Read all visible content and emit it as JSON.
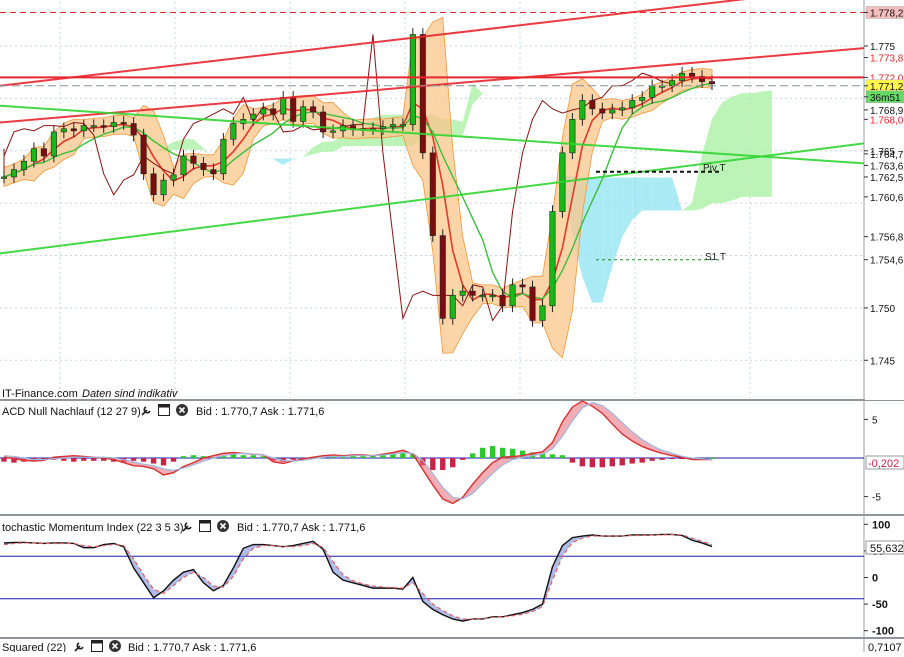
{
  "colors": {
    "resistance_line": "#e8262d",
    "support_line": "#31d431",
    "bollinger_fill": "#f9c78b",
    "cloud_bull": "#a6f0a0",
    "cloud_bear": "#8ee3f2",
    "candle_up": "#18b818",
    "candle_down": "#7a0d0d",
    "price_line": "#2a2a2a",
    "macd_pos_bar": "#2ec72e",
    "macd_neg_bar": "#c8244a",
    "zero_line": "#1b1bb0",
    "grid": "#c6d7e6",
    "axis_text": "#111111",
    "highlight_label_bg": "#fff84a",
    "current_label_bg": "#66d966",
    "top_label_bg": "#f5bdbd"
  },
  "main_panel": {
    "watermark": "IT-Finance.com",
    "disclaimer": "Daten sind indikativ",
    "level_tags": {
      "pivot": "Piv T",
      "s1": "S1 T"
    },
    "price_labels": [
      "1.778,2",
      "1.775",
      "1.773,8",
      "1.772,0",
      "1.771,2",
      "36m51",
      "1.768,9",
      "1.768,0",
      "1.765",
      "1.764,7",
      "1.763,6",
      "1.762,5",
      "1.760,6",
      "1.756,8",
      "1.754,6",
      "1.750",
      "1.745"
    ]
  },
  "macd_panel": {
    "title": "ACD Null Nachlauf (12 27 9)",
    "bid_ask": "Bid : 1.770,7 Ask : 1.771,6",
    "axis_ticks": [
      "5",
      "-5"
    ],
    "current_value": "-0,202"
  },
  "smi_panel": {
    "title": "tochastic Momentum Index (22 3 5 3)",
    "bid_ask": "Bid : 1.770,7 Ask : 1.771,6",
    "axis_ticks": [
      "100",
      "50",
      "0",
      "-50",
      "-100"
    ],
    "current_value": "55,632"
  },
  "bottom_panel": {
    "title": "Squared (22)",
    "bid_ask": "Bid : 1.770,7 Ask : 1.771,6",
    "current_value": "0,7107"
  },
  "toolbar_icons": [
    "wrench-icon",
    "window-icon",
    "close-icon"
  ],
  "chart_data": [
    {
      "type": "line",
      "name": "main-price",
      "y_axis_ticks": [
        1.745,
        1.75,
        1.755,
        1.76,
        1.765,
        1.77,
        1.775
      ],
      "ylim": [
        1.7414,
        1.7792
      ],
      "x": [
        0,
        10,
        20,
        30,
        40,
        50,
        60,
        70,
        80,
        90,
        100,
        110,
        120,
        130,
        140,
        150,
        160,
        170,
        180,
        190,
        200,
        210,
        220,
        230,
        240,
        250,
        260,
        270,
        280,
        290,
        300,
        310,
        320,
        330,
        340,
        350,
        360,
        370,
        380,
        390,
        400,
        410,
        420,
        430,
        440,
        450,
        460,
        470,
        480,
        490,
        500,
        510,
        520,
        530,
        540,
        550,
        560,
        570,
        580,
        590,
        600,
        610,
        620,
        630,
        640,
        650,
        660,
        670,
        680,
        690,
        700,
        710
      ],
      "close": [
        1.7625,
        1.7632,
        1.764,
        1.7652,
        1.7645,
        1.7668,
        1.7671,
        1.7669,
        1.7674,
        1.7674,
        1.7673,
        1.7677,
        1.7676,
        1.7665,
        1.7628,
        1.7608,
        1.7622,
        1.7627,
        1.7645,
        1.7638,
        1.7632,
        1.7628,
        1.7661,
        1.7676,
        1.768,
        1.7685,
        1.769,
        1.7685,
        1.7701,
        1.7678,
        1.7692,
        1.7687,
        1.7668,
        1.7669,
        1.7674,
        1.767,
        1.7671,
        1.7671,
        1.7673,
        1.7675,
        1.7675,
        1.7761,
        1.7648,
        1.7569,
        1.749,
        1.7512,
        1.7516,
        1.7512,
        1.7512,
        1.7512,
        1.7502,
        1.7522,
        1.752,
        1.7488,
        1.7502,
        1.7592,
        1.7648,
        1.768,
        1.7698,
        1.769,
        1.7686,
        1.7689,
        1.7691,
        1.7698,
        1.7701,
        1.7712,
        1.7712,
        1.7717,
        1.7724,
        1.7721,
        1.7716,
        1.7714
      ],
      "series": [
        {
          "name": "",
          "kind": "trendline",
          "color": "#e8262d",
          "y_at_start": 1.7712,
          "y_at_end": 1.7808
        },
        {
          "name": "",
          "kind": "trendline",
          "color": "#e8262d",
          "y_at_start": 1.7677,
          "y_at_end": 1.7748
        },
        {
          "name": "",
          "kind": "horizontal",
          "color": "#e8262d",
          "y": 1.772
        },
        {
          "name": "",
          "kind": "trendline",
          "color": "#31d431",
          "y_at_start": 1.7693,
          "y_at_end": 1.7638
        },
        {
          "name": "",
          "kind": "trendline",
          "color": "#31d431",
          "y_at_start": 1.7552,
          "y_at_end": 1.7657
        }
      ],
      "levels": {
        "top_dashed": 1.7782,
        "pivot": 1.763,
        "s1": 1.7546
      },
      "last_price": 1.7712
    },
    {
      "type": "bar",
      "name": "macd",
      "ylim": [
        -7,
        7
      ],
      "axis_ticks": [
        5,
        -5
      ],
      "x": [
        0,
        10,
        20,
        30,
        40,
        50,
        60,
        70,
        80,
        90,
        100,
        110,
        120,
        130,
        140,
        150,
        160,
        170,
        180,
        190,
        200,
        210,
        220,
        230,
        240,
        250,
        260,
        270,
        280,
        290,
        300,
        310,
        320,
        330,
        340,
        350,
        360,
        370,
        380,
        390,
        400,
        410,
        420,
        430,
        440,
        450,
        460,
        470,
        480,
        490,
        500,
        510,
        520,
        530,
        540,
        550,
        560,
        570,
        580,
        590,
        600,
        610,
        620,
        630,
        640,
        650,
        660,
        670,
        680,
        690,
        700,
        710
      ],
      "histogram": [
        -0.4,
        -0.5,
        -0.4,
        -0.3,
        -0.2,
        -0.2,
        -0.3,
        -0.4,
        -0.3,
        -0.3,
        -0.3,
        -0.4,
        -0.5,
        -0.3,
        -0.4,
        -0.6,
        -0.8,
        -0.4,
        0.2,
        0.3,
        0.2,
        0.1,
        0.2,
        0.4,
        0.3,
        0.3,
        0.2,
        -0.3,
        -0.4,
        -0.2,
        -0.1,
        0.1,
        0.1,
        0.2,
        0.1,
        0.2,
        0.2,
        0.3,
        0.3,
        0.5,
        0.6,
        0.4,
        -0.8,
        -1.3,
        -1.3,
        -1.0,
        -0.2,
        0.5,
        1.1,
        1.3,
        1.1,
        1.0,
        0.8,
        0.6,
        0.5,
        0.4,
        0.3,
        -0.5,
        -0.9,
        -1.0,
        -1.0,
        -0.9,
        -0.8,
        -0.6,
        -0.5,
        -0.3,
        -0.2,
        -0.1,
        -0.1,
        0.0,
        0.0,
        0.0
      ],
      "macd_line": [
        0.1,
        -0.1,
        -0.3,
        -0.4,
        -0.3,
        0.1,
        0.2,
        0.3,
        0.2,
        0.1,
        0.0,
        -0.2,
        -0.6,
        -1.0,
        -1.1,
        -1.4,
        -2.2,
        -1.9,
        -1.1,
        -0.6,
        0.0,
        0.3,
        0.6,
        0.7,
        0.6,
        0.5,
        0.4,
        -0.5,
        -0.7,
        -0.4,
        -0.1,
        0.1,
        0.3,
        0.4,
        0.3,
        0.4,
        0.4,
        0.3,
        0.5,
        0.7,
        1.0,
        0.5,
        -1.5,
        -3.5,
        -5.3,
        -5.9,
        -5.1,
        -3.4,
        -1.9,
        -0.6,
        0.1,
        0.2,
        0.3,
        0.6,
        0.8,
        2.0,
        4.7,
        6.6,
        7.4,
        6.7,
        5.8,
        4.4,
        3.1,
        2.2,
        1.5,
        1.0,
        0.6,
        0.3,
        0.1,
        -0.2,
        -0.2,
        -0.2
      ],
      "signal_line": [
        0.3,
        0.2,
        0.0,
        -0.2,
        -0.2,
        -0.1,
        0.0,
        0.1,
        0.1,
        0.1,
        0.1,
        0.0,
        -0.2,
        -0.5,
        -0.8,
        -1.0,
        -1.4,
        -1.6,
        -1.3,
        -0.9,
        -0.4,
        0.0,
        0.3,
        0.5,
        0.6,
        0.5,
        0.4,
        0.0,
        -0.3,
        -0.4,
        -0.3,
        -0.1,
        0.1,
        0.2,
        0.2,
        0.3,
        0.3,
        0.3,
        0.4,
        0.5,
        0.7,
        0.6,
        -0.3,
        -2.0,
        -3.8,
        -5.1,
        -5.3,
        -4.6,
        -3.3,
        -2.0,
        -0.9,
        -0.2,
        0.1,
        0.3,
        0.5,
        1.2,
        2.8,
        4.8,
        6.5,
        7.2,
        6.8,
        5.8,
        4.6,
        3.4,
        2.4,
        1.6,
        1.0,
        0.6,
        0.2,
        0.0,
        -0.1,
        -0.2
      ]
    },
    {
      "type": "line",
      "name": "smi",
      "ylim": [
        -110,
        110
      ],
      "axis_ticks": [
        100,
        50,
        0,
        -50,
        -100
      ],
      "reference_lines": [
        40,
        -40
      ],
      "x": [
        0,
        10,
        20,
        30,
        40,
        50,
        60,
        70,
        80,
        90,
        100,
        110,
        120,
        130,
        140,
        150,
        160,
        170,
        180,
        190,
        200,
        210,
        220,
        230,
        240,
        250,
        260,
        270,
        280,
        290,
        300,
        310,
        320,
        330,
        340,
        350,
        360,
        370,
        380,
        390,
        400,
        410,
        420,
        430,
        440,
        450,
        460,
        470,
        480,
        490,
        500,
        510,
        520,
        530,
        540,
        550,
        560,
        570,
        580,
        590,
        600,
        610,
        620,
        630,
        640,
        650,
        660,
        670,
        680,
        690,
        700,
        710
      ],
      "smi": [
        65,
        66,
        66,
        65,
        64,
        65,
        65,
        64,
        56,
        56,
        62,
        64,
        58,
        18,
        -10,
        -38,
        -25,
        -5,
        10,
        15,
        -10,
        -25,
        -15,
        18,
        55,
        62,
        62,
        60,
        58,
        60,
        64,
        68,
        53,
        10,
        -5,
        -10,
        -15,
        -20,
        -20,
        -20,
        -22,
        0,
        -45,
        -60,
        -70,
        -78,
        -82,
        -78,
        -78,
        -74,
        -74,
        -70,
        -66,
        -60,
        -50,
        20,
        60,
        75,
        78,
        80,
        78,
        78,
        78,
        80,
        80,
        80,
        81,
        81,
        79,
        70,
        65,
        58
      ],
      "signal": [
        62,
        64,
        65,
        65,
        64,
        64,
        64,
        64,
        60,
        58,
        60,
        62,
        60,
        35,
        5,
        -22,
        -30,
        -15,
        0,
        10,
        0,
        -16,
        -18,
        2,
        35,
        55,
        60,
        60,
        58,
        58,
        60,
        64,
        57,
        30,
        5,
        -6,
        -12,
        -16,
        -18,
        -19,
        -20,
        -10,
        -30,
        -50,
        -62,
        -72,
        -78,
        -78,
        -77,
        -75,
        -74,
        -72,
        -69,
        -64,
        -55,
        -5,
        40,
        66,
        74,
        78,
        78,
        78,
        78,
        79,
        79,
        80,
        80,
        81,
        80,
        74,
        68,
        62
      ]
    }
  ]
}
